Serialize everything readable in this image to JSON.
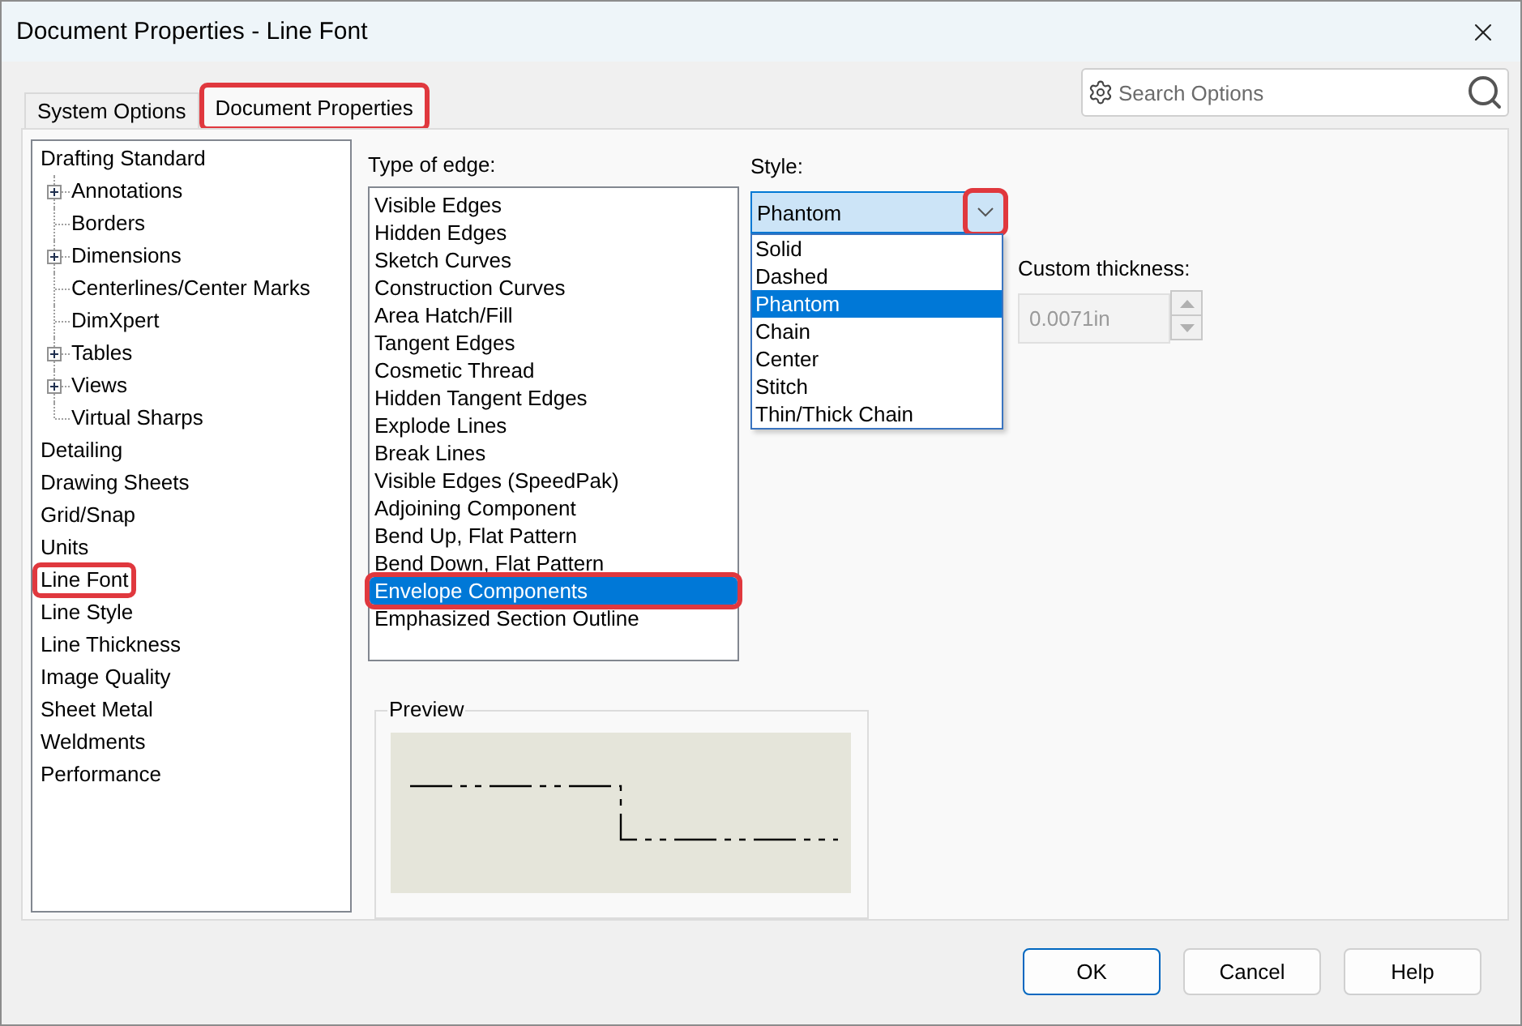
{
  "window": {
    "title": "Document Properties - Line Font"
  },
  "tabs": [
    {
      "label": "System Options",
      "selected": false,
      "highlighted": false
    },
    {
      "label": "Document Properties",
      "selected": true,
      "highlighted": true
    }
  ],
  "search": {
    "placeholder": "Search Options"
  },
  "tree": [
    {
      "label": "Drafting Standard",
      "highlighted": false,
      "children": [
        {
          "label": "Annotations",
          "expanded": false,
          "highlighted": false
        },
        {
          "label": "Borders",
          "highlighted": false
        },
        {
          "label": "Dimensions",
          "expanded": false,
          "highlighted": false
        },
        {
          "label": "Centerlines/Center Marks",
          "highlighted": false
        },
        {
          "label": "DimXpert",
          "highlighted": false
        },
        {
          "label": "Tables",
          "expanded": false,
          "highlighted": false
        },
        {
          "label": "Views",
          "expanded": false,
          "highlighted": false
        },
        {
          "label": "Virtual Sharps",
          "highlighted": false
        }
      ]
    },
    {
      "label": "Detailing",
      "highlighted": false
    },
    {
      "label": "Drawing Sheets",
      "highlighted": false
    },
    {
      "label": "Grid/Snap",
      "highlighted": false
    },
    {
      "label": "Units",
      "highlighted": false
    },
    {
      "label": "Line Font",
      "highlighted": true
    },
    {
      "label": "Line Style",
      "highlighted": false
    },
    {
      "label": "Line Thickness",
      "highlighted": false
    },
    {
      "label": "Image Quality",
      "highlighted": false
    },
    {
      "label": "Sheet Metal",
      "highlighted": false
    },
    {
      "label": "Weldments",
      "highlighted": false
    },
    {
      "label": "Performance",
      "highlighted": false
    }
  ],
  "edge_types": {
    "label": "Type of edge:",
    "items": [
      {
        "label": "Visible Edges",
        "selected": false,
        "highlighted": false
      },
      {
        "label": "Hidden Edges",
        "selected": false,
        "highlighted": false
      },
      {
        "label": "Sketch Curves",
        "selected": false,
        "highlighted": false
      },
      {
        "label": "Construction Curves",
        "selected": false,
        "highlighted": false
      },
      {
        "label": "Area Hatch/Fill",
        "selected": false,
        "highlighted": false
      },
      {
        "label": "Tangent Edges",
        "selected": false,
        "highlighted": false
      },
      {
        "label": "Cosmetic Thread",
        "selected": false,
        "highlighted": false
      },
      {
        "label": "Hidden Tangent Edges",
        "selected": false,
        "highlighted": false
      },
      {
        "label": "Explode Lines",
        "selected": false,
        "highlighted": false
      },
      {
        "label": "Break Lines",
        "selected": false,
        "highlighted": false
      },
      {
        "label": "Visible Edges (SpeedPak)",
        "selected": false,
        "highlighted": false
      },
      {
        "label": "Adjoining Component",
        "selected": false,
        "highlighted": false
      },
      {
        "label": "Bend Up, Flat Pattern",
        "selected": false,
        "highlighted": false
      },
      {
        "label": "Bend Down, Flat Pattern",
        "selected": false,
        "highlighted": false
      },
      {
        "label": "Envelope Components",
        "selected": true,
        "highlighted": true
      },
      {
        "label": "Emphasized Section Outline",
        "selected": false,
        "highlighted": false
      }
    ]
  },
  "style": {
    "label": "Style:",
    "value": "Phantom",
    "expanded": true,
    "button_highlighted": true,
    "options": [
      {
        "label": "Solid",
        "selected": false
      },
      {
        "label": "Dashed",
        "selected": false
      },
      {
        "label": "Phantom",
        "selected": true
      },
      {
        "label": "Chain",
        "selected": false
      },
      {
        "label": "Center",
        "selected": false
      },
      {
        "label": "Stitch",
        "selected": false
      },
      {
        "label": "Thin/Thick Chain",
        "selected": false
      }
    ]
  },
  "custom_thickness": {
    "label": "Custom thickness:",
    "value": "0.0071in",
    "disabled": true
  },
  "preview": {
    "label": "Preview"
  },
  "buttons": [
    {
      "label": "OK",
      "default": true
    },
    {
      "label": "Cancel",
      "default": false
    },
    {
      "label": "Help",
      "default": false
    }
  ]
}
